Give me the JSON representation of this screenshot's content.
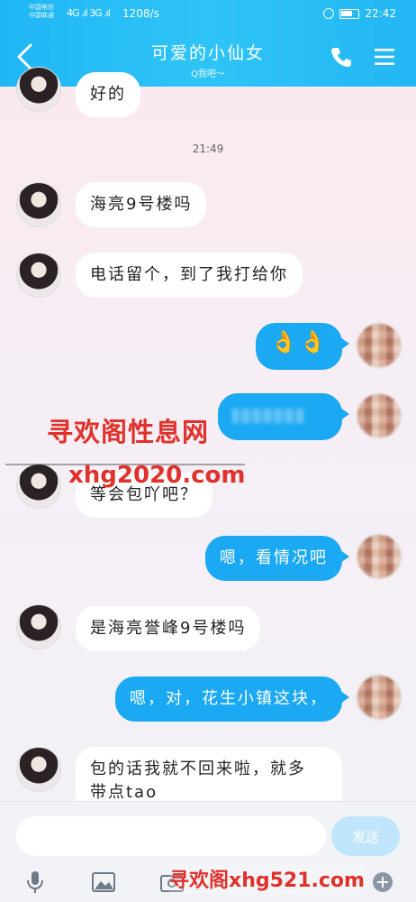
{
  "status": {
    "carrier_top": "中国电信",
    "carrier_bottom": "中国联通",
    "signal": "4G .ıl 3G .ıl",
    "speed": "1208/s",
    "time": "22:42"
  },
  "header": {
    "title": "可爱的小仙女",
    "subtitle": "Q我吧～"
  },
  "messages": {
    "m0": "好的",
    "timestamp": "21:49",
    "m1": "海亮9号楼吗",
    "m2": "电话留个，到了我打给你",
    "m3": "👌👌",
    "m5": "等会包吖吧？",
    "m6": "嗯，看情况吧",
    "m7": "是海亮誉峰9号楼吗",
    "m8": "嗯，对，花生小镇这块，",
    "m9_line1": "包的话我就不回来啦，就多",
    "m9_line2": "带点tao"
  },
  "watermark": {
    "line1": "寻欢阁性息网",
    "line2": "xhg2020.com",
    "line3": "寻欢阁xhg521.com"
  },
  "input": {
    "placeholder": "",
    "send_label": "发送"
  },
  "icons": {
    "back": "back-arrow-icon",
    "phone": "phone-icon",
    "menu": "menu-icon",
    "mic": "microphone-icon",
    "image": "image-icon",
    "camera": "camera-icon",
    "plus": "plus-icon"
  },
  "colors": {
    "header": "#23b6f4",
    "bubble_out": "#1aa9f2",
    "watermark": "#e0312b"
  }
}
